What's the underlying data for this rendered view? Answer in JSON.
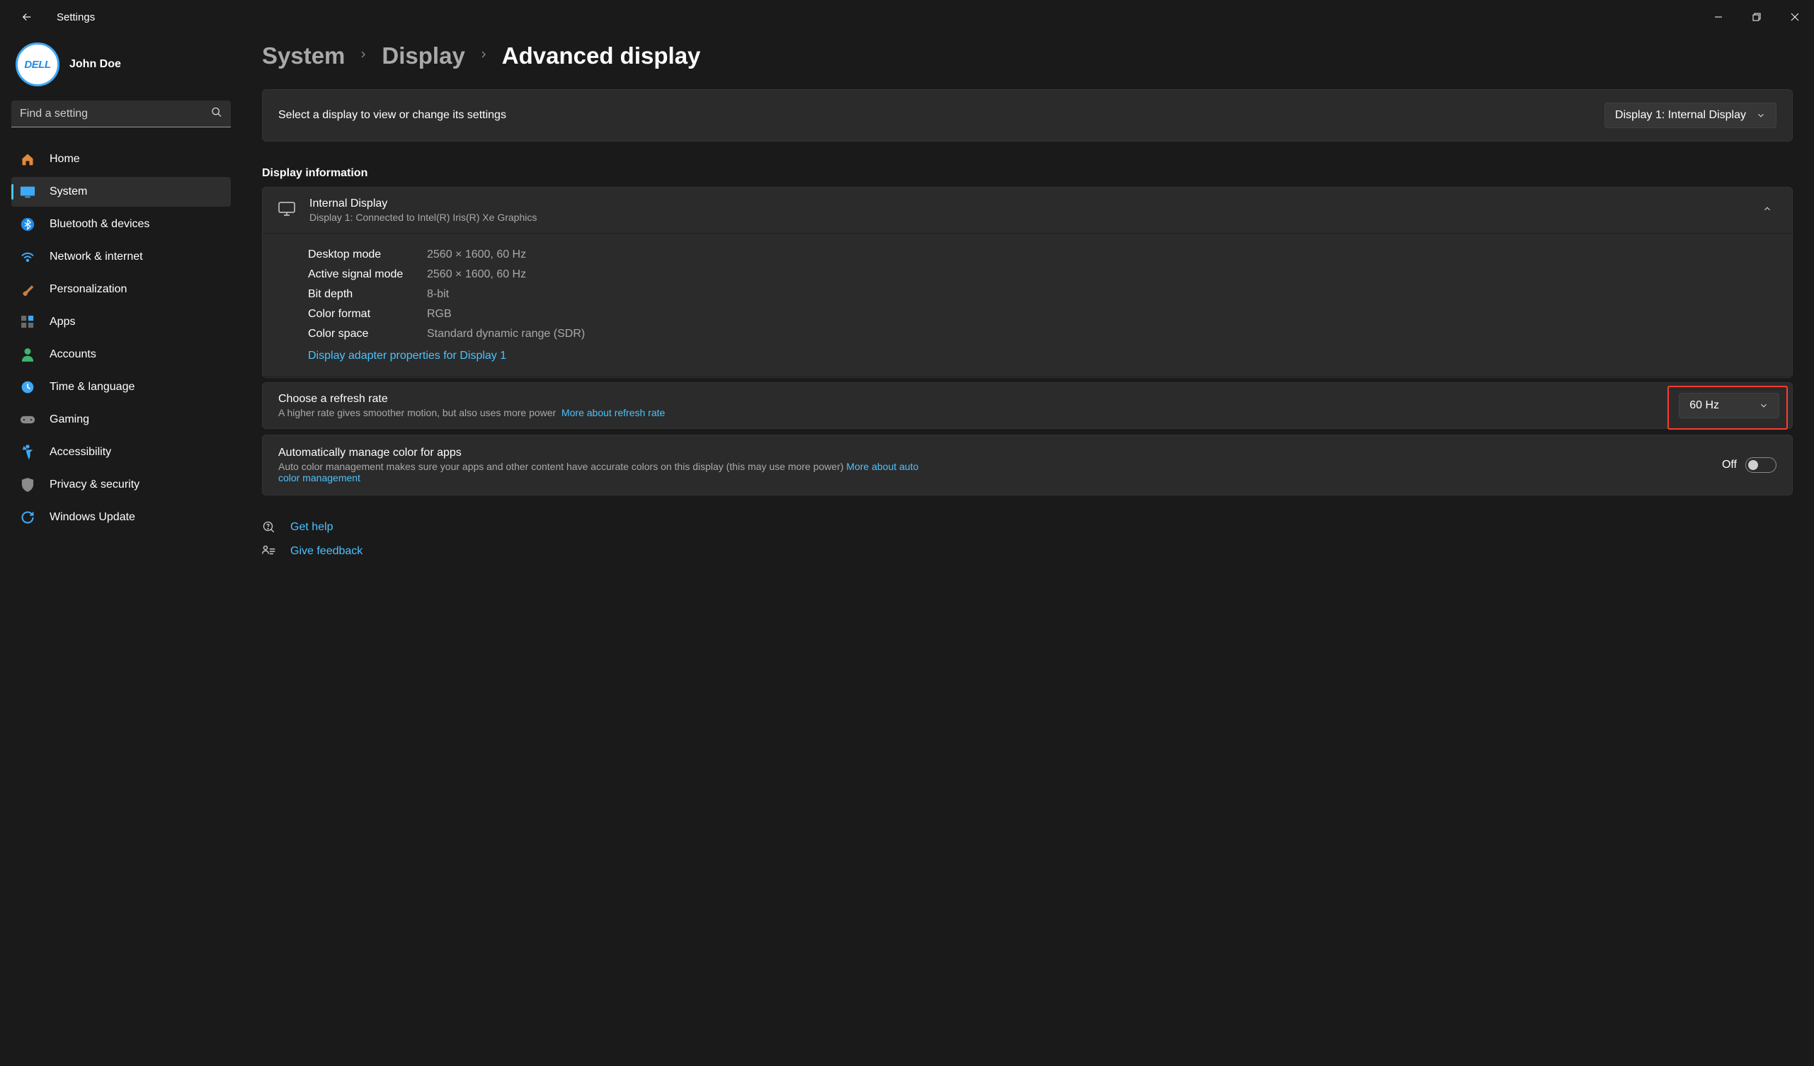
{
  "app": {
    "title": "Settings"
  },
  "user": {
    "name": "John Doe",
    "avatar_text": "DELL"
  },
  "search": {
    "placeholder": "Find a setting"
  },
  "nav": [
    {
      "label": "Home"
    },
    {
      "label": "System"
    },
    {
      "label": "Bluetooth & devices"
    },
    {
      "label": "Network & internet"
    },
    {
      "label": "Personalization"
    },
    {
      "label": "Apps"
    },
    {
      "label": "Accounts"
    },
    {
      "label": "Time & language"
    },
    {
      "label": "Gaming"
    },
    {
      "label": "Accessibility"
    },
    {
      "label": "Privacy & security"
    },
    {
      "label": "Windows Update"
    }
  ],
  "breadcrumb": {
    "a": "System",
    "b": "Display",
    "c": "Advanced display"
  },
  "select_display": {
    "label": "Select a display to view or change its settings",
    "value": "Display 1: Internal Display"
  },
  "section": {
    "display_info": "Display information"
  },
  "display_info": {
    "name": "Internal Display",
    "sub": "Display 1: Connected to Intel(R) Iris(R) Xe Graphics",
    "rows": {
      "desktop_mode_k": "Desktop mode",
      "desktop_mode_v": "2560 × 1600, 60 Hz",
      "active_mode_k": "Active signal mode",
      "active_mode_v": "2560 × 1600, 60 Hz",
      "bit_depth_k": "Bit depth",
      "bit_depth_v": "8-bit",
      "color_format_k": "Color format",
      "color_format_v": "RGB",
      "color_space_k": "Color space",
      "color_space_v": "Standard dynamic range (SDR)"
    },
    "adapter_link": "Display adapter properties for Display 1"
  },
  "refresh": {
    "title": "Choose a refresh rate",
    "sub": "A higher rate gives smoother motion, but also uses more power",
    "link": "More about refresh rate",
    "value": "60 Hz"
  },
  "color_mgmt": {
    "title": "Automatically manage color for apps",
    "sub": "Auto color management makes sure your apps and other content have accurate colors on this display (this may use more power)",
    "link": "More about auto color management",
    "toggle_label": "Off"
  },
  "footer": {
    "help": "Get help",
    "feedback": "Give feedback"
  }
}
